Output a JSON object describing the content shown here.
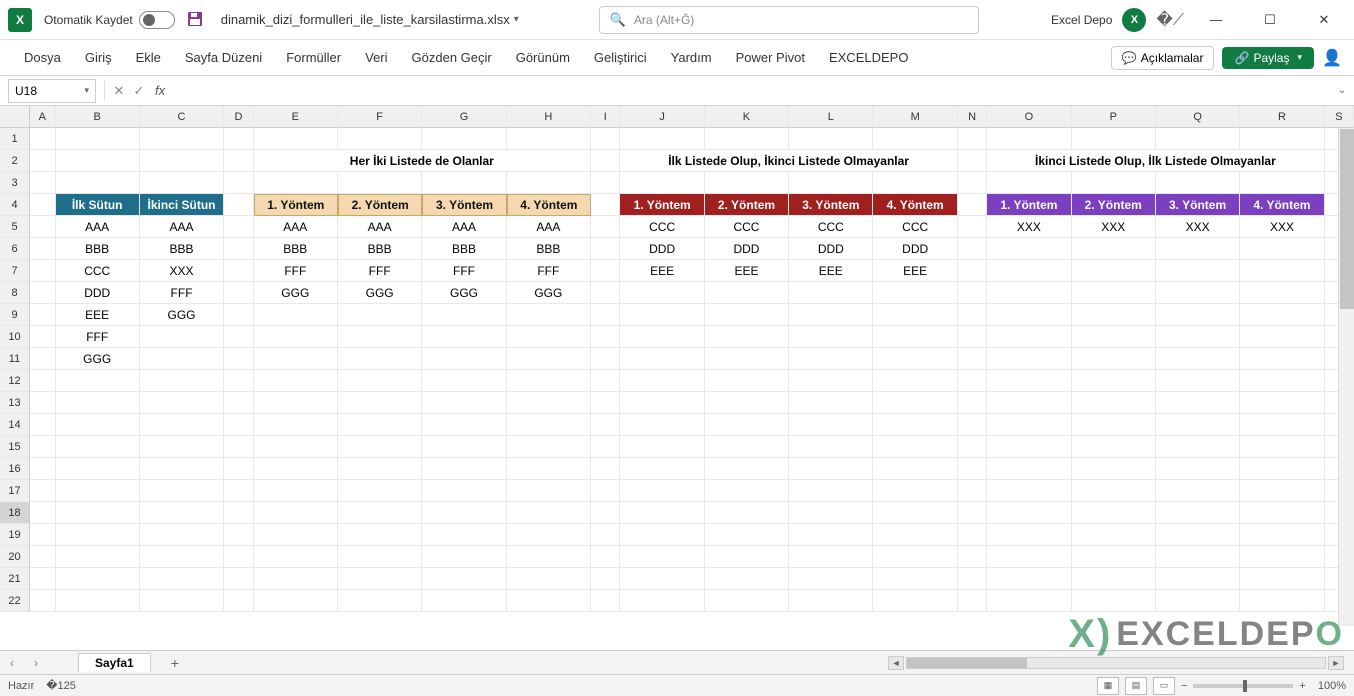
{
  "title": {
    "autosave_label": "Otomatik Kaydet",
    "filename": "dinamik_dizi_formulleri_ile_liste_karsilastirma.xlsx",
    "filename_suffix": "▾",
    "search_placeholder": "Ara (Alt+Ğ)",
    "user_name": "Excel Depo",
    "user_initials": "X"
  },
  "ribbon": {
    "tabs": [
      "Dosya",
      "Giriş",
      "Ekle",
      "Sayfa Düzeni",
      "Formüller",
      "Veri",
      "Gözden Geçir",
      "Görünüm",
      "Geliştirici",
      "Yardım",
      "Power Pivot",
      "EXCELDEPO"
    ],
    "comments": "Açıklamalar",
    "share": "Paylaş"
  },
  "formula": {
    "namebox": "U18",
    "value": ""
  },
  "columns": [
    "A",
    "B",
    "C",
    "D",
    "E",
    "F",
    "G",
    "H",
    "I",
    "J",
    "K",
    "L",
    "M",
    "N",
    "O",
    "P",
    "Q",
    "R",
    "S"
  ],
  "rows": [
    "1",
    "2",
    "3",
    "4",
    "5",
    "6",
    "7",
    "8",
    "9",
    "10",
    "11",
    "12",
    "13",
    "14",
    "15",
    "16",
    "17",
    "18",
    "19",
    "20",
    "21",
    "22"
  ],
  "sections": {
    "title1": "Her İki Listede de Olanlar",
    "title2": "İlk Listede Olup, İkinci Listede Olmayanlar",
    "title3": "İkinci Listede Olup, İlk Listede Olmayanlar"
  },
  "headers": {
    "B": "İlk Sütun",
    "C": "İkinci Sütun",
    "y1": "1. Yöntem",
    "y2": "2. Yöntem",
    "y3": "3. Yöntem",
    "y4": "4. Yöntem"
  },
  "data": {
    "B": [
      "AAA",
      "BBB",
      "CCC",
      "DDD",
      "EEE",
      "FFF",
      "GGG"
    ],
    "C": [
      "AAA",
      "BBB",
      "XXX",
      "FFF",
      "GGG"
    ],
    "both": [
      "AAA",
      "BBB",
      "FFF",
      "GGG"
    ],
    "only1": [
      "CCC",
      "DDD",
      "EEE"
    ],
    "only2": [
      "XXX"
    ]
  },
  "sheet": {
    "tab": "Sayfa1"
  },
  "status": {
    "ready": "Hazır",
    "zoom": "100%"
  },
  "watermark": {
    "brand": "EXCELDE",
    "suffix1": "P",
    "suffix2": "O"
  }
}
